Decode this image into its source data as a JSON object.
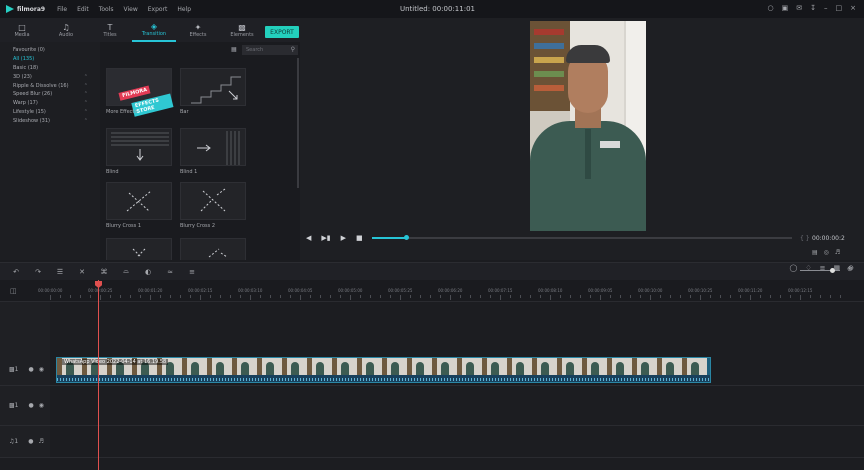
{
  "app": {
    "name": "filmora9",
    "menu": [
      "File",
      "Edit",
      "Tools",
      "View",
      "Export",
      "Help"
    ],
    "window_title": "Untitled: 00:00:11:01"
  },
  "toolbar": {
    "tabs": [
      {
        "label": "Media",
        "icon": "folder-icon"
      },
      {
        "label": "Audio",
        "icon": "music-icon"
      },
      {
        "label": "Titles",
        "icon": "text-icon"
      },
      {
        "label": "Transition",
        "icon": "transition-icon"
      },
      {
        "label": "Effects",
        "icon": "effects-icon"
      },
      {
        "label": "Elements",
        "icon": "elements-icon"
      }
    ],
    "active_tab": "Transition",
    "export_label": "EXPORT"
  },
  "categories": [
    {
      "label": "Favourite (0)",
      "arrow": false
    },
    {
      "label": "All (135)",
      "arrow": false,
      "selected": true
    },
    {
      "label": "Basic (18)",
      "arrow": false
    },
    {
      "label": "3D (23)",
      "arrow": true
    },
    {
      "label": "Ripple & Dissolve (16)",
      "arrow": true
    },
    {
      "label": "Speed Blur (26)",
      "arrow": true
    },
    {
      "label": "Warp (17)",
      "arrow": true
    },
    {
      "label": "Lifestyle (15)",
      "arrow": true
    },
    {
      "label": "Slideshow (31)",
      "arrow": true
    }
  ],
  "library": {
    "search_placeholder": "Search",
    "items": [
      {
        "label": "More Effects",
        "badge_top": "FILMORA",
        "badge_bottom": "EFFECTS STORE"
      },
      {
        "label": "Bar"
      },
      {
        "label": "Blind"
      },
      {
        "label": "Blind 1"
      },
      {
        "label": "Blurry Cross 1"
      },
      {
        "label": "Blurry Cross 2"
      }
    ]
  },
  "preview": {
    "progress": 0.08,
    "timecode": "00:00:00:2"
  },
  "timeline": {
    "ruler": [
      "00:00:00:00",
      "00:00:00:25",
      "00:00:01:20",
      "00:00:02:15",
      "00:00:03:10",
      "00:00:04:05",
      "00:00:05:00",
      "00:00:05:25",
      "00:00:06:20",
      "00:00:07:15",
      "00:00:08:10",
      "00:00:09:05",
      "00:00:10:00",
      "00:00:10:25",
      "00:00:11:20",
      "00:00:12:15"
    ],
    "clip_label": "WhatsApp Video 2022-04-14 at 16.19.58",
    "tracks": [
      {
        "label": "1",
        "type": "video"
      },
      {
        "label": "1",
        "type": "video"
      },
      {
        "label": "1",
        "type": "audio"
      }
    ]
  }
}
